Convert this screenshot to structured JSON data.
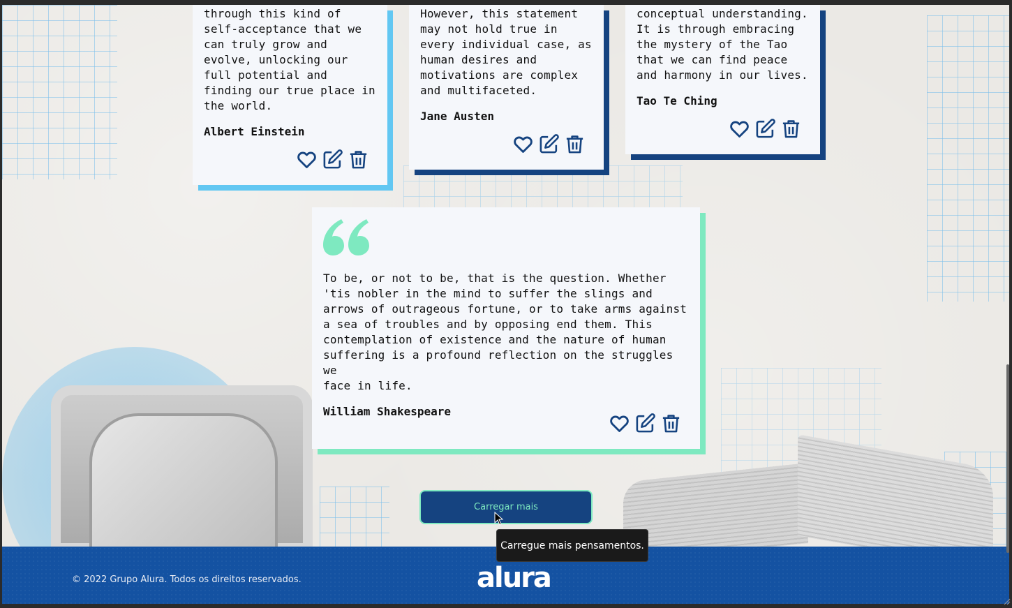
{
  "colors": {
    "card_bg": "#f5f7fb",
    "shadow_light_blue": "#62c7f2",
    "shadow_dark_blue": "#154380",
    "shadow_mint": "#7ee9c0",
    "icon": "#154380",
    "button_bg": "#154380",
    "button_text": "#7ee9c0",
    "footer_bg": "#1452a2"
  },
  "cards_top": [
    {
      "text": "through this kind of\nself-acceptance that we\ncan truly grow and\nevolve, unlocking our\nfull potential and\nfinding our true place in\nthe world.",
      "author": "Albert Einstein"
    },
    {
      "text": "However, this statement\nmay not hold true in\nevery individual case, as\nhuman desires and\nmotivations are complex\nand multifaceted.",
      "author": "Jane Austen"
    },
    {
      "text": "conceptual understanding.\nIt is through embracing\nthe mystery of the Tao\nthat we can find peace\nand harmony in our lives.",
      "author": "Tao Te Ching"
    }
  ],
  "featured_card": {
    "icon": "quote-icon",
    "text": "To be, or not to be, that is the question. Whether\n'tis nobler in the mind to suffer the slings and\narrows of outrageous fortune, or to take arms against\na sea of troubles and by opposing end them. This\ncontemplation of existence and the nature of human\nsuffering is a profound reflection on the struggles we\nface in life.",
    "author": "William Shakespeare"
  },
  "actions": {
    "favorite_icon": "heart-icon",
    "edit_icon": "edit-icon",
    "delete_icon": "trash-icon"
  },
  "load_more": {
    "label": "Carregar mais",
    "tooltip": "Carregue mais pensamentos."
  },
  "footer": {
    "copyright": "© 2022 Grupo Alura. Todos os direitos reservados.",
    "logo": "alura"
  }
}
